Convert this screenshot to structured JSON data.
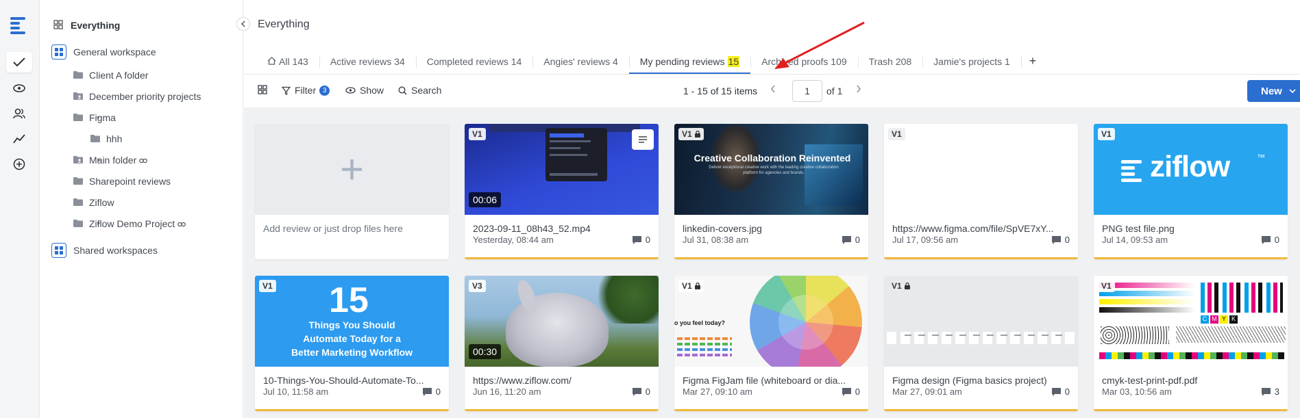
{
  "sidebar": {
    "everything": "Everything",
    "general_workspace": "General workspace",
    "items": [
      {
        "label": "Client A folder"
      },
      {
        "label": "December priority projects"
      },
      {
        "label": "Figma"
      },
      {
        "label": "hhh"
      },
      {
        "label": "Main folder"
      },
      {
        "label": "Sharepoint reviews"
      },
      {
        "label": "Ziflow"
      },
      {
        "label": "Ziflow Demo Project"
      }
    ],
    "shared_workspaces": "Shared workspaces"
  },
  "header": {
    "title": "Everything"
  },
  "tabs": [
    {
      "label": "All",
      "count": "143"
    },
    {
      "label": "Active reviews",
      "count": "34"
    },
    {
      "label": "Completed reviews",
      "count": "14"
    },
    {
      "label": "Angies' reviews",
      "count": "4"
    },
    {
      "label": "My pending reviews",
      "count": "15"
    },
    {
      "label": "Archived proofs",
      "count": "109"
    },
    {
      "label": "Trash",
      "count": "208"
    },
    {
      "label": "Jamie's projects",
      "count": "1"
    }
  ],
  "tab_add": "+",
  "toolbar": {
    "filter": "Filter",
    "filter_count": "3",
    "show": "Show",
    "search": "Search",
    "pager_text": "1 - 15 of 15 items",
    "page_value": "1",
    "page_of": "of 1",
    "new": "New"
  },
  "add_card": {
    "plus": "+",
    "hint": "Add review or just drop files here"
  },
  "cards": [
    {
      "version": "V1",
      "name": "2023-09-11_08h43_52.mp4",
      "date": "Yesterday, 08:44 am",
      "comments": "0",
      "duration": "00:06"
    },
    {
      "version": "V1",
      "name": "linkedin-covers.jpg",
      "date": "Jul 31, 08:38 am",
      "comments": "0",
      "thumb_title": "Creative Collaboration Reinvented",
      "thumb_sub": "Deliver exceptional creative work with the leading creative collaboration platform for agencies and brands."
    },
    {
      "version": "V1",
      "name": "https://www.figma.com/file/SpVE7xY...",
      "date": "Jul 17, 09:56 am",
      "comments": "0"
    },
    {
      "version": "V1",
      "name": "PNG test file.png",
      "date": "Jul 14, 09:53 am",
      "comments": "0",
      "logo": "ziflow",
      "tm": "™"
    },
    {
      "version": "V1",
      "name": "10-Things-You-Should-Automate-To...",
      "date": "Jul 10, 11:58 am",
      "comments": "0",
      "big": "15",
      "thumb_lines": [
        "Things You Should",
        "Automate Today for a",
        "Better Marketing Workflow"
      ]
    },
    {
      "version": "V3",
      "name": "https://www.ziflow.com/",
      "date": "Jun 16, 11:20 am",
      "comments": "0",
      "duration": "00:30"
    },
    {
      "version": "V1",
      "name": "Figma FigJam file (whiteboard or dia...",
      "date": "Mar 27, 09:10 am",
      "comments": "0",
      "thumb_q": "o you feel today?"
    },
    {
      "version": "V1",
      "name": "Figma design (Figma basics project)",
      "date": "Mar 27, 09:01 am",
      "comments": "0"
    },
    {
      "version": "V1",
      "name": "cmyk-test-print-pdf.pdf",
      "date": "Mar 03, 10:56 am",
      "comments": "3",
      "letters": [
        "C",
        "M",
        "Y",
        "K"
      ]
    }
  ]
}
